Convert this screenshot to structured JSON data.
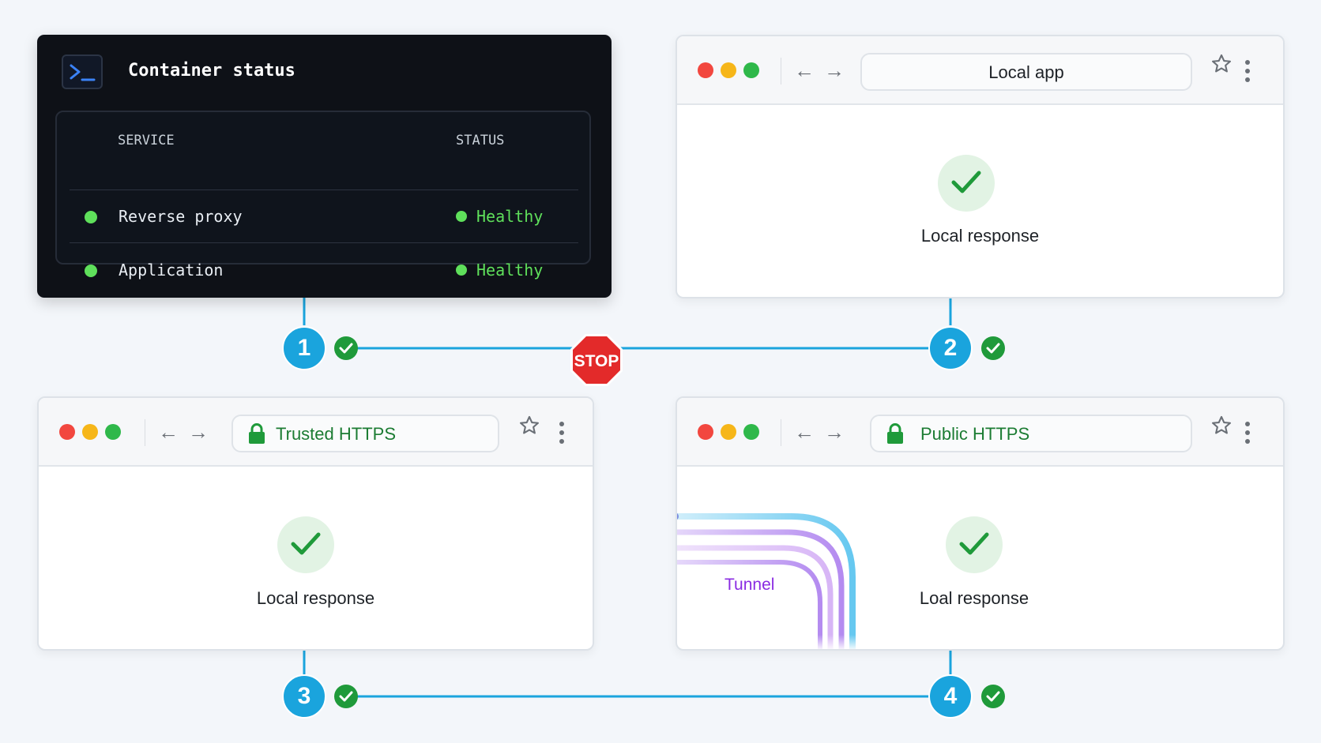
{
  "terminal": {
    "title": "Container status",
    "icon": "terminal-icon",
    "columns": {
      "service": "SERVICE",
      "status": "STATUS"
    },
    "rows": [
      {
        "service": "Reverse proxy",
        "status": "Healthy"
      },
      {
        "service": "Application",
        "status": "Healthy"
      }
    ]
  },
  "browsers": {
    "local_app": {
      "url": "Local app",
      "response": "Local response"
    },
    "trusted_https": {
      "url": "Trusted HTTPS",
      "response": "Local response"
    },
    "public_https": {
      "url": "Public HTTPS",
      "response": "Loal response"
    }
  },
  "steps": {
    "one": "1",
    "two": "2",
    "three": "3",
    "four": "4"
  },
  "stop_sign": "STOP",
  "tunnel_label": "Tunnel",
  "colors": {
    "accent": "#1aa4dd",
    "healthy": "#5fe05b",
    "secure": "#1f9a3a",
    "stop": "#e32a2a",
    "tunnel": "#8a2be2"
  }
}
